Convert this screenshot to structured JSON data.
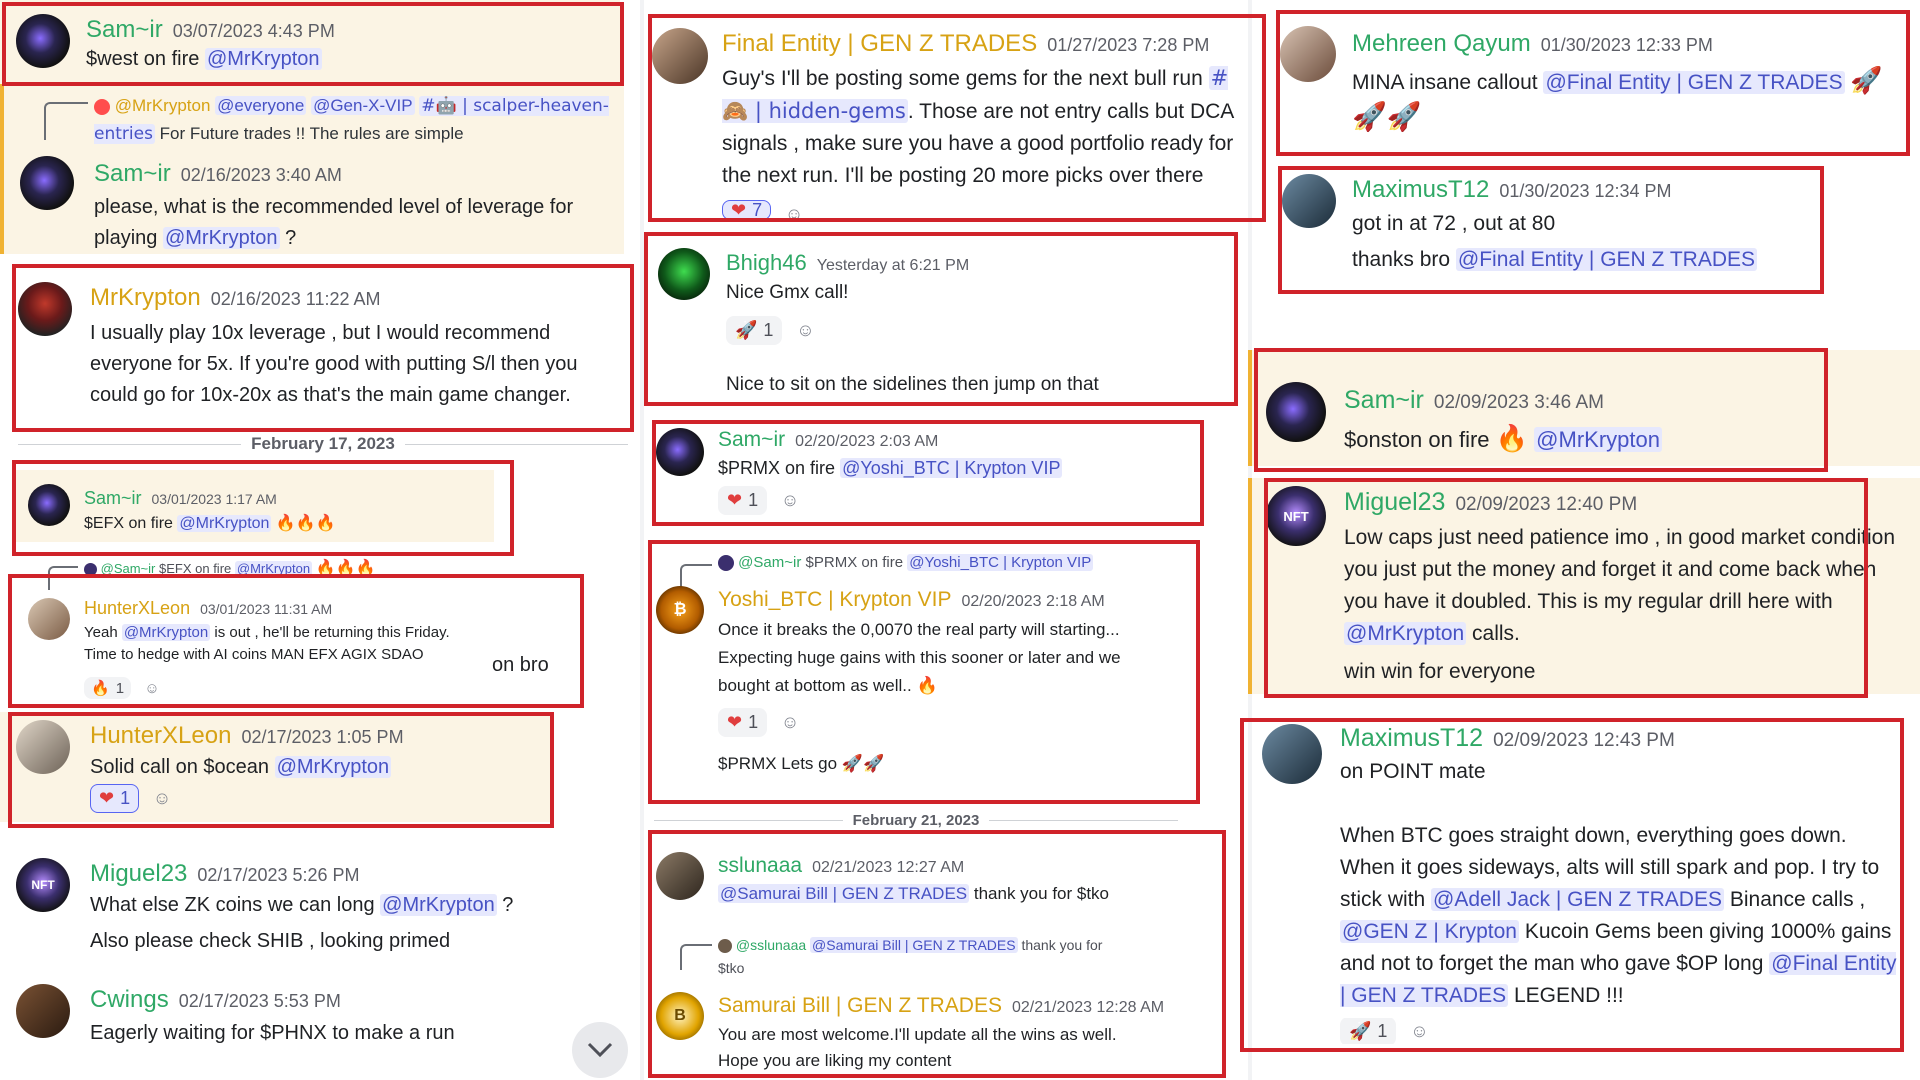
{
  "col1": {
    "m1": {
      "user": "Sam~ir",
      "time": "03/07/2023 4:43 PM",
      "text": "$west on fire",
      "mention": "@MrKrypton"
    },
    "reply1": {
      "mention1": "@MrKrypton",
      "mention2": "@everyone",
      "mention3": "@Gen-X-VIP",
      "channel": "#🤖 | scalper-heaven-entries",
      "rest": "For Future trades !! The rules are simple"
    },
    "m2": {
      "user": "Sam~ir",
      "time": "02/16/2023 3:40 AM",
      "text": "please, what is the recommended level of leverage for playing",
      "mention": "@MrKrypton",
      "tail": "?"
    },
    "m3": {
      "user": "MrKrypton",
      "time": "02/16/2023 11:22 AM",
      "text": "I usually play 10x leverage , but I would recommend everyone for 5x. If you're good with putting S/l then you could go for 10x-20x as that's the main game changer."
    },
    "divider1": "February 17, 2023",
    "m4": {
      "user": "Sam~ir",
      "time": "03/01/2023 1:17 AM",
      "text": "$EFX on fire",
      "mention": "@MrKrypton",
      "emoji": "🔥🔥🔥"
    },
    "reply2": {
      "user": "@Sam~ir",
      "text": "$EFX on fire",
      "mention": "@MrKrypton",
      "emoji": "🔥🔥🔥"
    },
    "m5": {
      "user": "HunterXLeon",
      "time": "03/01/2023 11:31 AM",
      "line1a": "Yeah",
      "mention": "@MrKrypton",
      "line1b": "is out , he'll be returning this Friday.",
      "line2": "Time to hedge with AI coins MAN EFX AGIX SDAO",
      "react_emoji": "🔥",
      "react_count": "1",
      "side": "on bro"
    },
    "m6": {
      "user": "HunterXLeon",
      "time": "02/17/2023 1:05 PM",
      "text": "Solid call on $ocean",
      "mention": "@MrKrypton",
      "react_emoji": "❤",
      "react_count": "1"
    },
    "m7": {
      "user": "Miguel23",
      "time": "02/17/2023 5:26 PM",
      "text": "What else ZK coins we can long",
      "mention": "@MrKrypton",
      "tail": "?",
      "line2": "Also please check SHIB , looking primed"
    },
    "m8": {
      "user": "Cwings",
      "time": "02/17/2023 5:53 PM",
      "text": "Eagerly waiting for $PHNX to make a run"
    }
  },
  "col2": {
    "m1": {
      "user": "Final Entity | GEN Z TRADES",
      "time": "01/27/2023 7:28 PM",
      "text1": "Guy's I'll be posting some gems for the next bull run",
      "channel": "# 🙈 | hidden-gems",
      "text2": ". Those are not entry calls but DCA signals , make sure you have a good portfolio ready for the next run. I'll be posting 20 more picks over there",
      "react_count": "7"
    },
    "m2": {
      "user": "Bhigh46",
      "time": "Yesterday at 6:21 PM",
      "text": "Nice Gmx call!",
      "react_emoji": "🚀",
      "react_count": "1",
      "line2": "Nice to sit on the sidelines then jump on that"
    },
    "m3": {
      "user": "Sam~ir",
      "time": "02/20/2023 2:03 AM",
      "text": "$PRMX on fire",
      "mention": "@Yoshi_BTC | Krypton VIP",
      "react_emoji": "❤",
      "react_count": "1"
    },
    "reply3": {
      "user": "@Sam~ir",
      "text": "$PRMX on fire",
      "mention": "@Yoshi_BTC | Krypton VIP"
    },
    "m4": {
      "user": "Yoshi_BTC | Krypton VIP",
      "time": "02/20/2023 2:18 AM",
      "line1": "Once it breaks the 0,0070 the real party will starting...",
      "line2": "Expecting huge gains with this sooner or later and we",
      "line3": "bought at bottom as well..",
      "emoji": "🔥",
      "react_emoji": "❤",
      "react_count": "1",
      "line4": "$PRMX Lets go",
      "emoji2": "🚀🚀"
    },
    "divider2": "February 21, 2023",
    "m5": {
      "user": "sslunaaa",
      "time": "02/21/2023 12:27 AM",
      "mention": "@Samurai Bill | GEN Z TRADES",
      "text": "thank you for $tko"
    },
    "reply4": {
      "user": "@sslunaaa",
      "mention": "@Samurai Bill | GEN Z TRADES",
      "text": "thank you for",
      "text2": "$tko"
    },
    "m6": {
      "user": "Samurai Bill | GEN Z TRADES",
      "time": "02/21/2023 12:28 AM",
      "line1": "You are most welcome.I'll update all the wins as well.",
      "line2": "Hope you are liking my content"
    }
  },
  "col3": {
    "m1": {
      "user": "Mehreen Qayum",
      "time": "01/30/2023 12:33 PM",
      "text": "MINA insane callout",
      "mention": "@Final Entity | GEN Z TRADES",
      "emoji": "🚀",
      "emoji2": "🚀🚀"
    },
    "m2": {
      "user": "MaximusT12",
      "time": "01/30/2023 12:34 PM",
      "line1": "got in at 72 , out at 80",
      "line2": "thanks bro",
      "mention": "@Final Entity | GEN Z TRADES"
    },
    "m3": {
      "user": "Sam~ir",
      "time": "02/09/2023 3:46 AM",
      "text": "$onston on fire",
      "emoji": "🔥",
      "mention": "@MrKrypton"
    },
    "m4": {
      "user": "Miguel23",
      "time": "02/09/2023 12:40 PM",
      "text": "Low caps just need patience imo , in good market condition you just put the money and forget it and come back when you have it doubled. This is my regular drill here with",
      "mention": "@MrKrypton",
      "tail": "calls.",
      "line2": "win win for everyone"
    },
    "m5": {
      "user": "MaximusT12",
      "time": "02/09/2023 12:43 PM",
      "line1": "on POINT mate",
      "p2a": "When BTC goes straight down, everything goes down. When it goes sideways, alts will still spark and pop. I try to stick with",
      "mention1": "@Adell Jack | GEN Z TRADES",
      "p2b": "Binance calls ,",
      "mention2": "@GEN Z | Krypton",
      "p2c": "Kucoin Gems been giving 1000% gains and not to forget the man who gave $OP long",
      "mention3": "@Final Entity | GEN Z TRADES",
      "p2d": "LEGEND !!!",
      "react_emoji": "🚀",
      "react_count": "1"
    }
  },
  "icons": {
    "add_reaction": "smile-plus-icon",
    "scroll": "chevron-down-icon"
  }
}
